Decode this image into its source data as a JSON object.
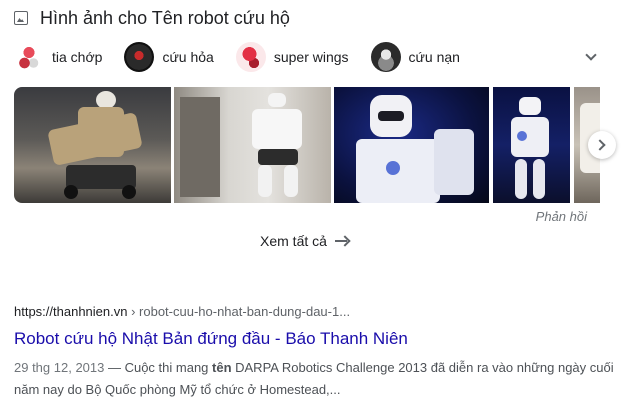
{
  "images_section": {
    "title": "Hình ảnh cho Tên robot cứu hộ",
    "chips": [
      {
        "label": "tia chớp"
      },
      {
        "label": "cứu hỏa"
      },
      {
        "label": "super wings"
      },
      {
        "label": "cứu nạn"
      }
    ],
    "feedback_label": "Phản hồi",
    "see_all_label": "Xem tất cả"
  },
  "result": {
    "site": "https://thanhnien.vn",
    "path": " › robot-cuu-ho-nhat-ban-dung-dau-1...",
    "title": "Robot cứu hộ Nhật Bản đứng đầu - Báo Thanh Niên",
    "date": "29 thg 12, 2013",
    "snippet_pre": " — Cuộc thi mang ",
    "snippet_bold": "tên",
    "snippet_post": " DARPA Robotics Challenge 2013 đã diễn ra vào những ngày cuối năm nay do Bộ Quốc phòng Mỹ tổ chức ở Homestead,..."
  },
  "colors": {
    "link": "#1a0dab",
    "text": "#202124",
    "muted": "#70757a"
  }
}
